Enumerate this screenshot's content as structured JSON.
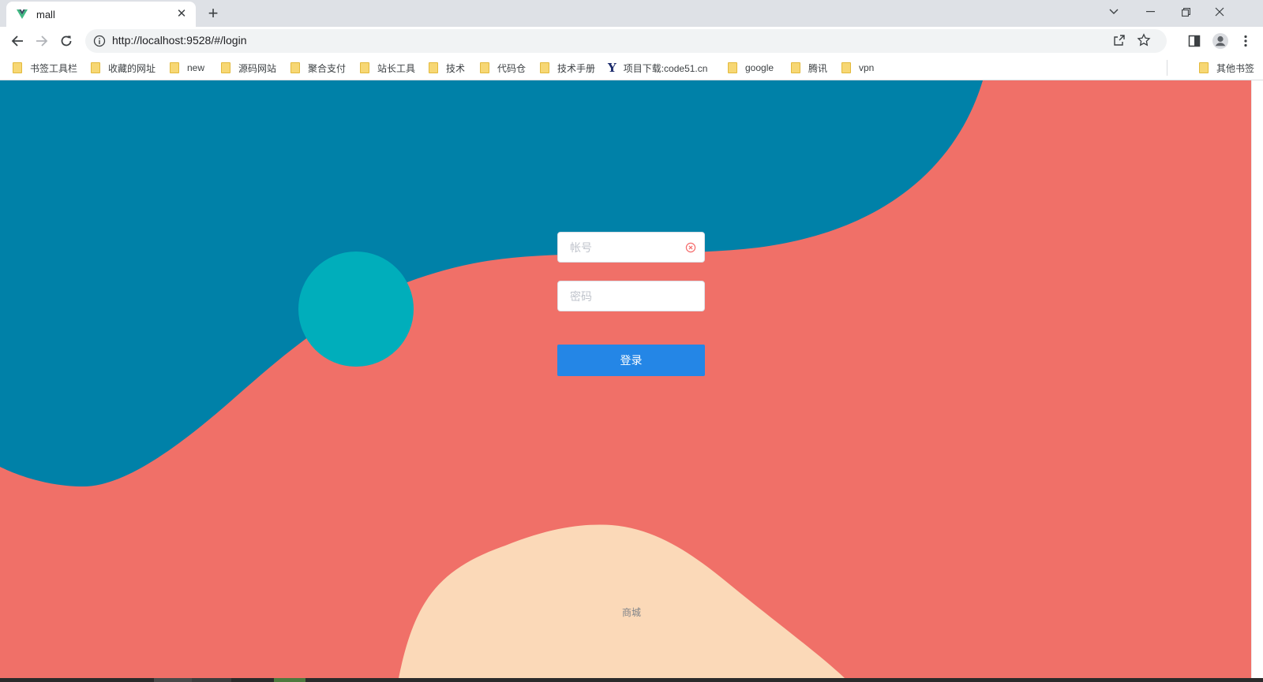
{
  "browser": {
    "tab_title": "mall",
    "url_prefix": "http://",
    "url_host": "localhost",
    "url_rest": ":9528/#/login"
  },
  "bookmarks": [
    {
      "label": "书签工具栏",
      "icon": "folder-icon"
    },
    {
      "label": "收藏的网址",
      "icon": "folder-icon"
    },
    {
      "label": "new",
      "icon": "folder-icon"
    },
    {
      "label": "源码网站",
      "icon": "folder-icon"
    },
    {
      "label": "聚合支付",
      "icon": "folder-icon"
    },
    {
      "label": "站长工具",
      "icon": "folder-icon"
    },
    {
      "label": "技术",
      "icon": "folder-icon"
    },
    {
      "label": "代码仓",
      "icon": "folder-icon"
    },
    {
      "label": "技术手册",
      "icon": "folder-icon"
    },
    {
      "label": "项目下载:code51.cn",
      "icon": "y-logo-icon"
    },
    {
      "label": "google",
      "icon": "folder-icon"
    },
    {
      "label": "腾讯",
      "icon": "folder-icon"
    },
    {
      "label": "vpn",
      "icon": "folder-icon"
    }
  ],
  "other_bookmarks": "其他书签",
  "login": {
    "username_placeholder": "帐号",
    "password_placeholder": "密码",
    "submit_label": "登录"
  },
  "footer": "商城",
  "colors": {
    "background_coral": "#f07068",
    "blob_blue": "#0081a8",
    "circle_teal": "#00aebb",
    "blob_peach": "#fbd9b8",
    "button_blue": "#2486e6"
  }
}
